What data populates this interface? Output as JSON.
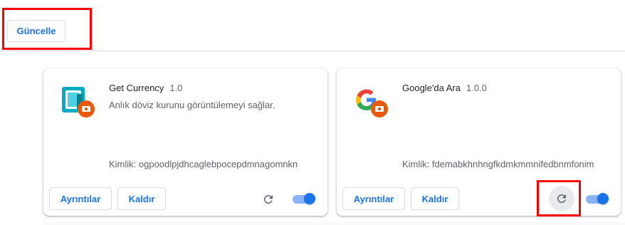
{
  "toolbar": {
    "update_label": "Güncelle"
  },
  "extensions": [
    {
      "name": "Get Currency",
      "version": "1.0",
      "description": "Anlık döviz kurunu görüntülemeyi sağlar.",
      "id_label": "Kimlik: ogpoodlpjdhcaglebpocepdmnagomnkn",
      "details_label": "Ayrıntılar",
      "remove_label": "Kaldır",
      "enabled": true,
      "icon": "currency-extension-icon"
    },
    {
      "name": "Google'da Ara",
      "version": "1.0.0",
      "description": "",
      "id_label": "Kimlik: fdemabkhnhngfkdmkmmnifedbnmfonim",
      "details_label": "Ayrıntılar",
      "remove_label": "Kaldır",
      "enabled": true,
      "icon": "google-g-icon"
    }
  ],
  "colors": {
    "accent": "#1a73e8",
    "highlight": "#ff0000",
    "toggle_track": "#8ab4f8"
  }
}
